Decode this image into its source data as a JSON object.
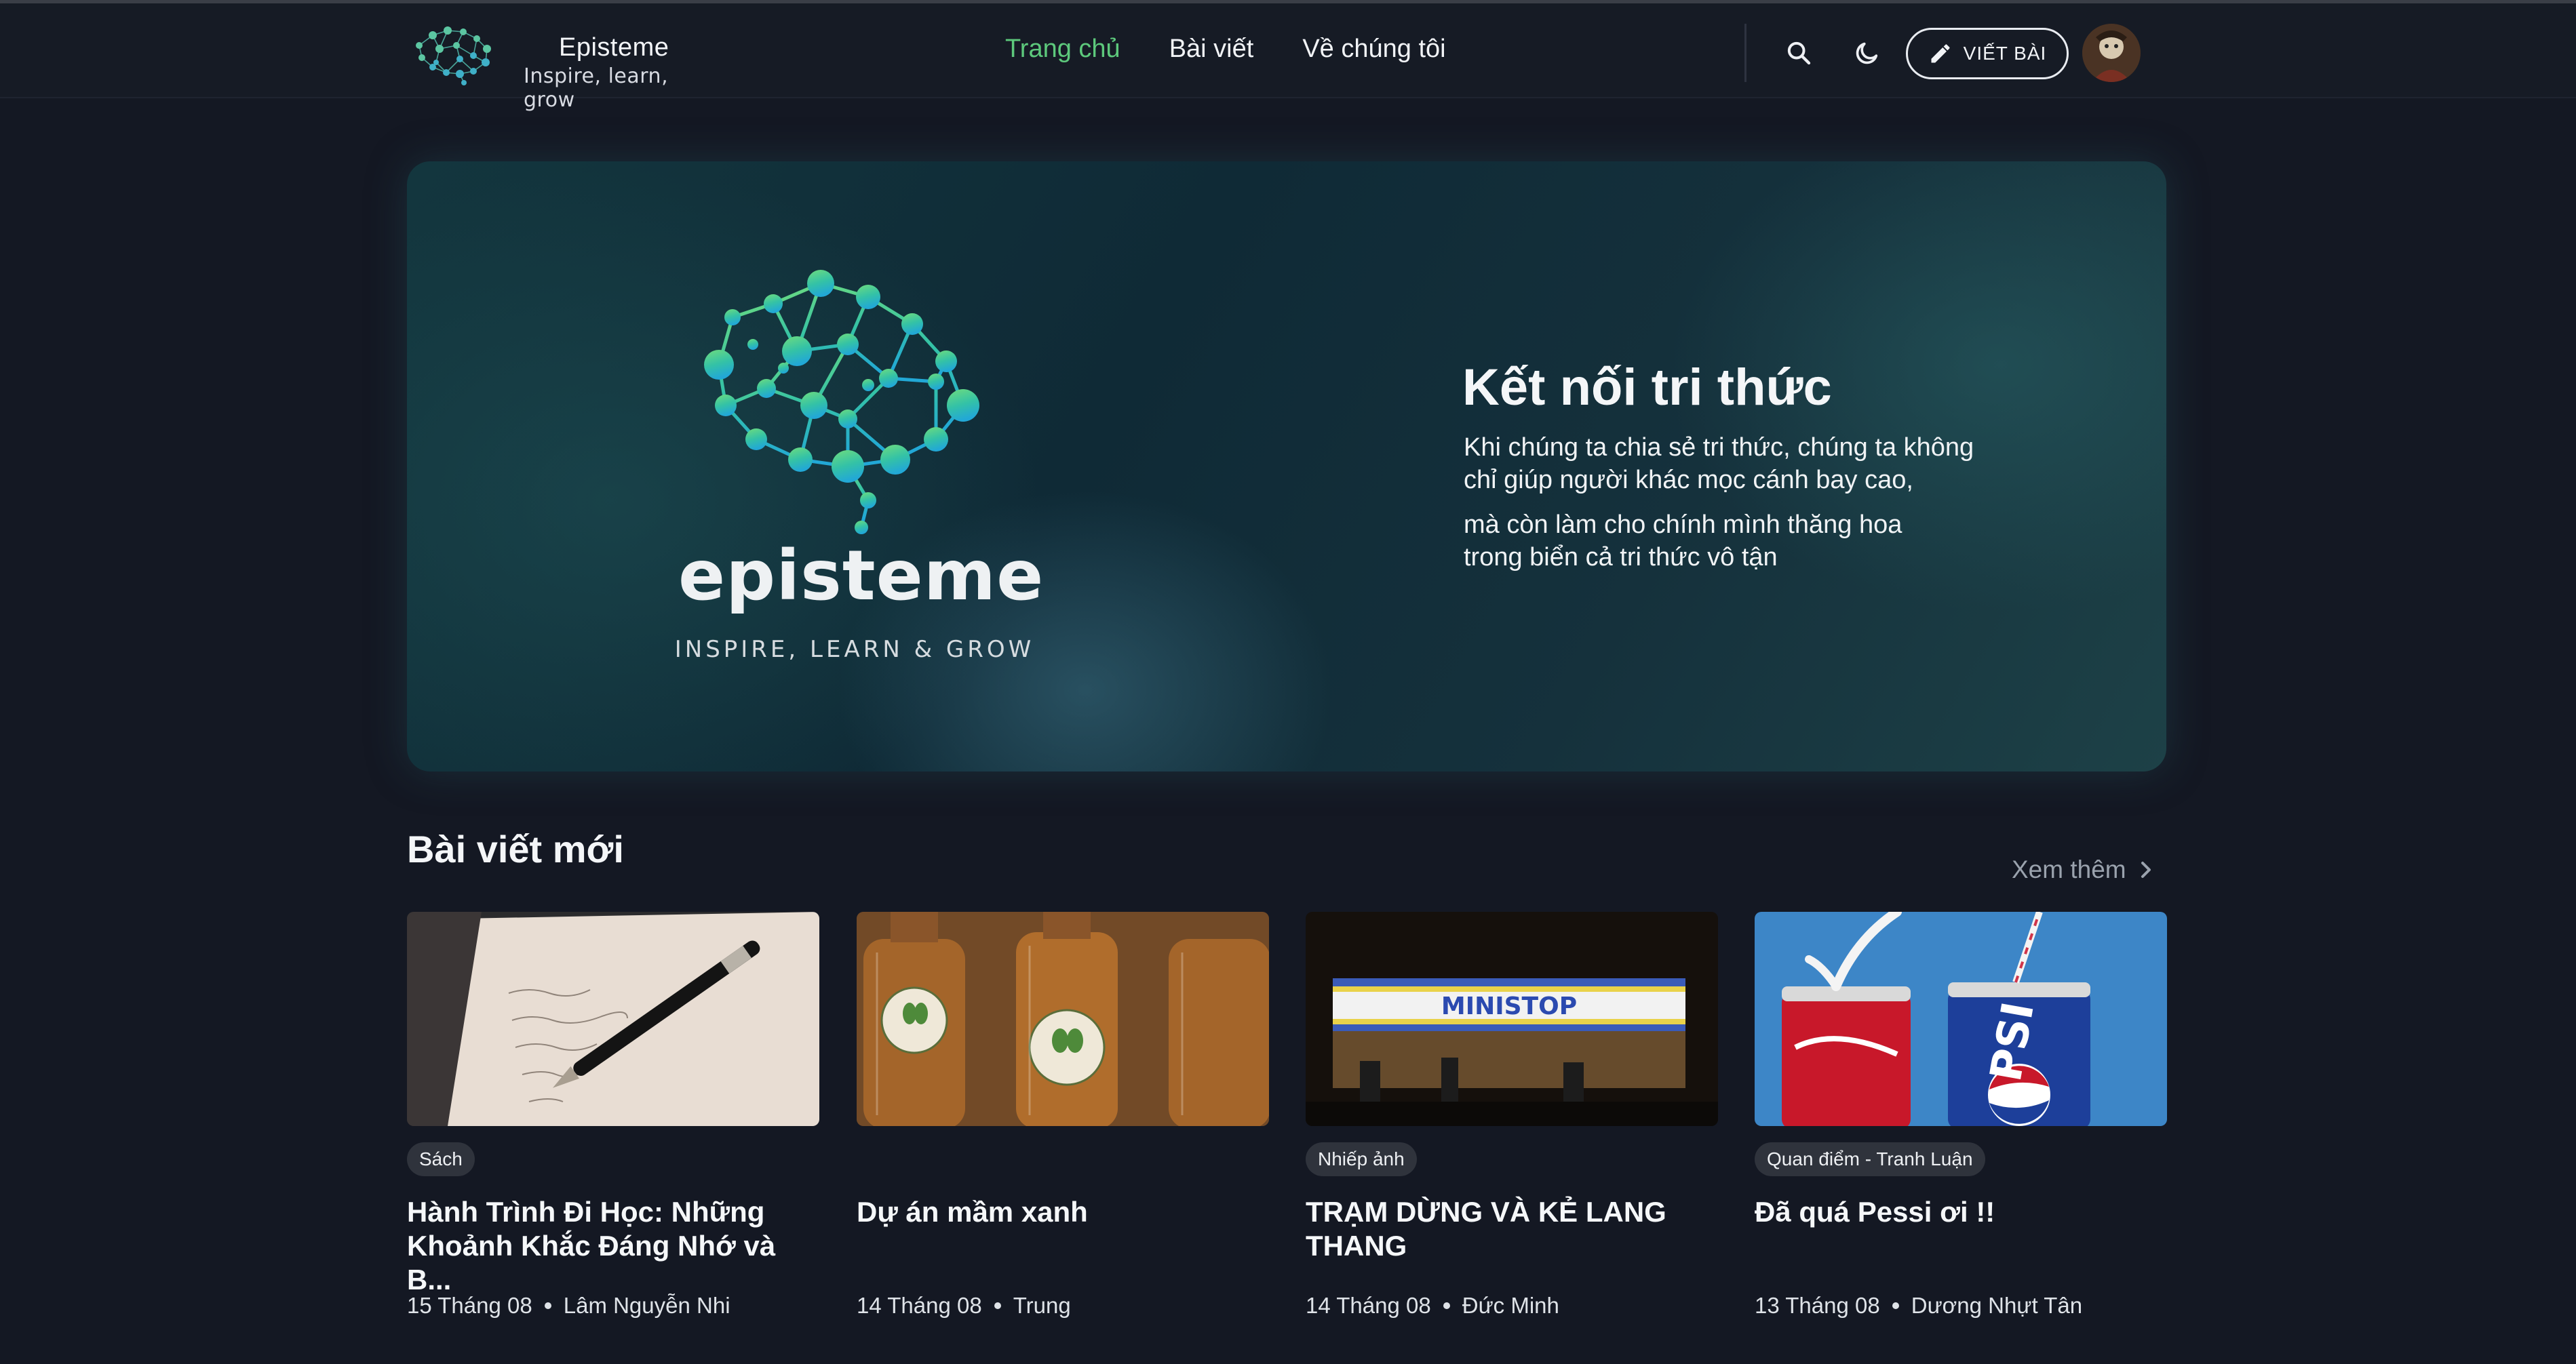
{
  "brand": {
    "name": "Episteme",
    "tagline": "Inspire, learn, grow"
  },
  "nav": [
    {
      "label": "Trang chủ",
      "active": true
    },
    {
      "label": "Bài viết",
      "active": false
    },
    {
      "label": "Về chúng tôi",
      "active": false
    }
  ],
  "header": {
    "search_icon": "search-icon",
    "theme_icon": "moon-icon",
    "write_button": "VIẾT BÀI",
    "write_icon": "pencil-icon"
  },
  "hero": {
    "logo_wordmark": "episteme",
    "logo_tagline": "INSPIRE, LEARN & GROW",
    "title": "Kết nối tri thức",
    "p1_line1": "Khi chúng ta chia sẻ tri thức, chúng ta không",
    "p1_line2": "chỉ giúp người khác mọc cánh bay cao,",
    "p2_line1": "mà còn làm cho chính mình thăng hoa",
    "p2_line2": "trong biển cả tri thức vô tận"
  },
  "latest": {
    "title": "Bài viết mới",
    "see_more": "Xem thêm",
    "posts": [
      {
        "category": "Sách",
        "title": "Hành Trình Đi Học: Những Khoảnh Khắc Đáng Nhớ và B...",
        "date": "15 Tháng 08",
        "author": "Lâm Nguyễn Nhi"
      },
      {
        "category": "",
        "title": "Dự án mầm xanh",
        "date": "14 Tháng 08",
        "author": "Trung"
      },
      {
        "category": "Nhiếp ảnh",
        "title": "TRẠM DỪNG VÀ KẺ LANG THANG",
        "date": "14 Tháng 08",
        "author": "Đức Minh"
      },
      {
        "category": "Quan điểm - Tranh Luận",
        "title": "Đã quá Pessi ơi !!",
        "date": "13 Tháng 08",
        "author": "Dương Nhựt Tân"
      }
    ],
    "thumb_texts": {
      "store_sign": "MINISTOP",
      "can_text": "PSI"
    }
  },
  "colors": {
    "accent": "#5dc97c",
    "background": "#141823",
    "muted": "#9aa2ad"
  }
}
